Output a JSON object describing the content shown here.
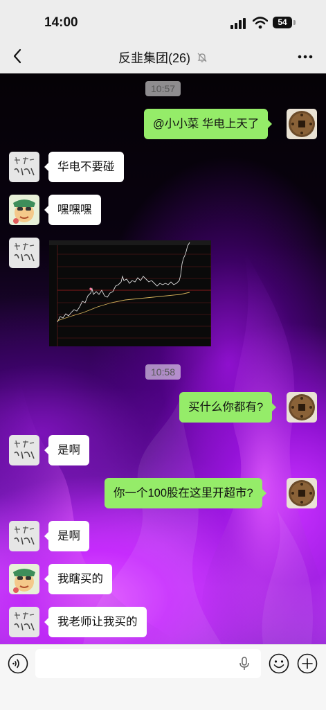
{
  "status_bar": {
    "time": "14:00",
    "battery": "54"
  },
  "nav": {
    "title": "反韭集团(26)",
    "back_icon": "chevron-left-icon",
    "more_icon": "more-dots-icon",
    "mute_icon": "bell-muted-icon"
  },
  "messages": {
    "ts1": "10:57",
    "m1": "@小小菜 华电上天了",
    "m2": "华电不要碰",
    "m3": "嘿嘿嘿",
    "ts2": "10:58",
    "m4": "买什么你都有?",
    "m5": "是啊",
    "m6": "你一个100股在这里开超市?",
    "m7": "是啊",
    "m8": "我瞎买的",
    "m9": "我老师让我买的"
  },
  "input_bar": {
    "voice_icon": "voice-icon",
    "mic_icon": "mic-icon",
    "emoji_icon": "emoji-icon",
    "plus_icon": "plus-icon"
  },
  "colors": {
    "outgoing_bubble": "#95ec69",
    "incoming_bubble": "#ffffff",
    "header_bg": "#ededed"
  }
}
